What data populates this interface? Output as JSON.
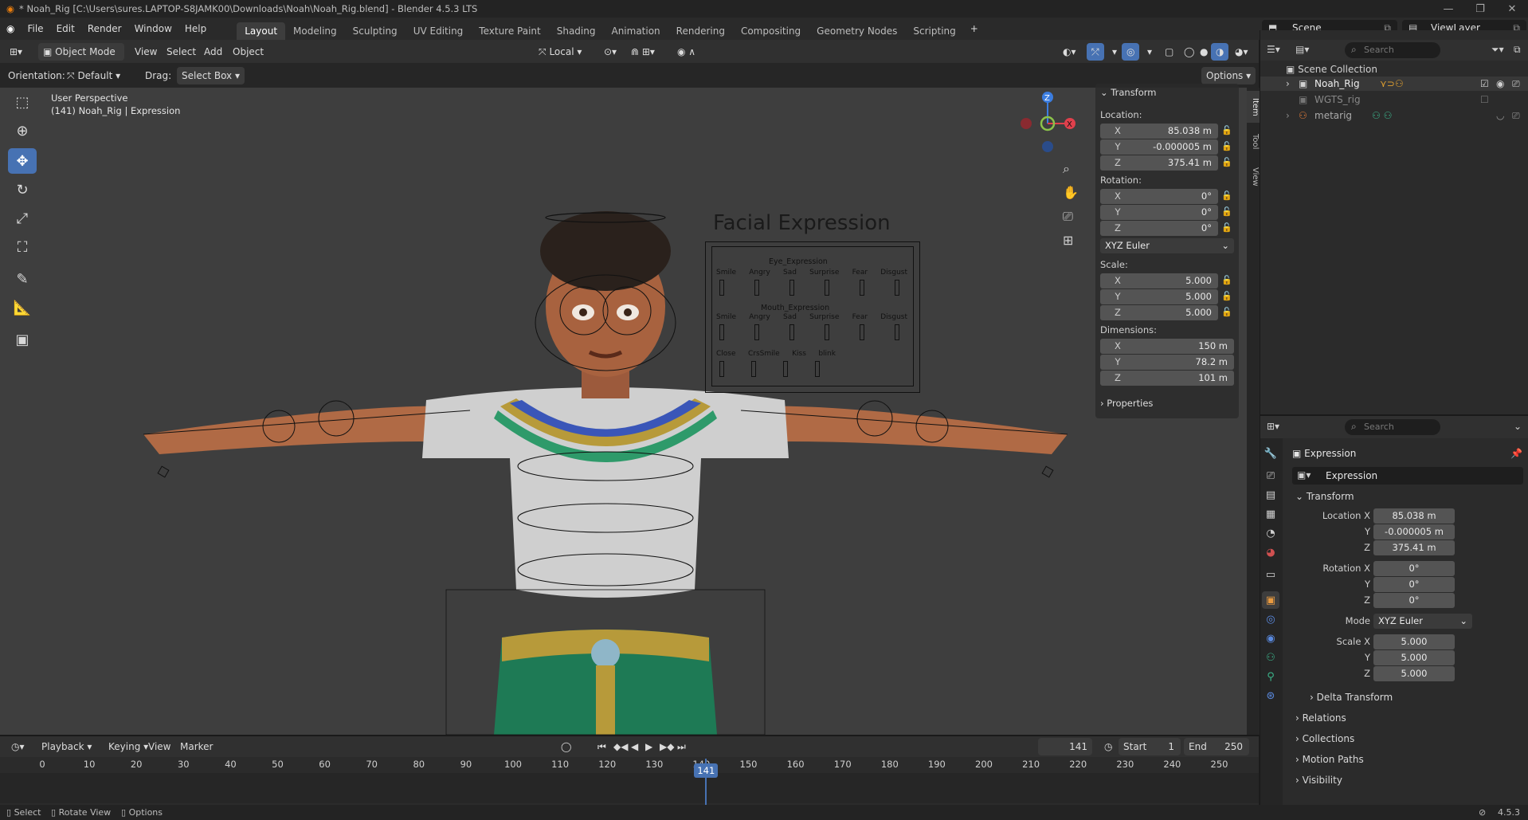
{
  "window": {
    "title": "* Noah_Rig [C:\\Users\\sures.LAPTOP-S8JAMK00\\Downloads\\Noah\\Noah_Rig.blend] - Blender 4.5.3 LTS"
  },
  "menubar": {
    "menus": [
      "File",
      "Edit",
      "Render",
      "Window",
      "Help"
    ],
    "workspaces": [
      "Layout",
      "Modeling",
      "Sculpting",
      "UV Editing",
      "Texture Paint",
      "Shading",
      "Animation",
      "Rendering",
      "Compositing",
      "Geometry Nodes",
      "Scripting"
    ],
    "active_workspace": "Layout",
    "scene": "Scene",
    "view_layer": "ViewLayer"
  },
  "viewport_header": {
    "mode": "Object Mode",
    "menus": [
      "View",
      "Select",
      "Add",
      "Object"
    ],
    "transform_orientation": "Local",
    "orientation_label": "Orientation:",
    "orientation_value": "Default",
    "drag_label": "Drag:",
    "drag_value": "Select Box",
    "options_label": "Options"
  },
  "viewport": {
    "perspective": "User Perspective",
    "object_info": "(141) Noah_Rig | Expression",
    "board": {
      "title": "Facial Expression",
      "eye_section": "Eye_Expression",
      "mouth_section": "Mouth_Expression",
      "eye_labels": [
        "Smile",
        "Angry",
        "Sad",
        "Surprise",
        "Fear",
        "Disgust"
      ],
      "mouth_labels": [
        "Smile",
        "Angry",
        "Sad",
        "Surprise",
        "Fear",
        "Disgust"
      ],
      "extra_labels": [
        "Close",
        "CrsSmile",
        "Kiss",
        "blink"
      ]
    }
  },
  "npanel": {
    "transform_header": "Transform",
    "location_label": "Location:",
    "location": {
      "x": "85.038 m",
      "y": "-0.000005 m",
      "z": "375.41 m"
    },
    "rotation_label": "Rotation:",
    "rotation": {
      "x": "0°",
      "y": "0°",
      "z": "0°"
    },
    "rotation_mode": "XYZ Euler",
    "scale_label": "Scale:",
    "scale": {
      "x": "5.000",
      "y": "5.000",
      "z": "5.000"
    },
    "dimensions_label": "Dimensions:",
    "dimensions": {
      "x": "150 m",
      "y": "78.2 m",
      "z": "101 m"
    },
    "properties_header": "Properties",
    "tabs": [
      "Item",
      "Tool",
      "View"
    ]
  },
  "outliner": {
    "search_placeholder": "Search",
    "root": "Scene Collection",
    "items": [
      {
        "name": "Noah_Rig"
      },
      {
        "name": "WGTS_rig"
      },
      {
        "name": "metarig"
      }
    ]
  },
  "properties": {
    "search_placeholder": "Search",
    "object_name": "Expression",
    "object_field": "Expression",
    "transform_header": "Transform",
    "location_x_label": "Location X",
    "location": {
      "x": "85.038 m",
      "y": "-0.000005 m",
      "z": "375.41 m"
    },
    "rotation_x_label": "Rotation X",
    "rotation": {
      "x": "0°",
      "y": "0°",
      "z": "0°"
    },
    "mode_label": "Mode",
    "mode_value": "XYZ Euler",
    "scale_x_label": "Scale X",
    "scale": {
      "x": "5.000",
      "y": "5.000",
      "z": "5.000"
    },
    "axis_y": "Y",
    "axis_z": "Z",
    "subsections": [
      "Delta Transform",
      "Relations",
      "Collections",
      "Motion Paths",
      "Visibility"
    ]
  },
  "timeline": {
    "menus": [
      "Playback",
      "Keying",
      "View",
      "Marker"
    ],
    "current_frame": "141",
    "start_label": "Start",
    "start": "1",
    "end_label": "End",
    "end": "250",
    "ticks": [
      "0",
      "10",
      "20",
      "30",
      "40",
      "50",
      "60",
      "70",
      "80",
      "90",
      "100",
      "110",
      "120",
      "130",
      "140",
      "150",
      "160",
      "170",
      "180",
      "190",
      "200",
      "210",
      "220",
      "230",
      "240",
      "250"
    ]
  },
  "statusbar": {
    "items": [
      "Select",
      "Rotate View",
      "Options"
    ],
    "version": "4.5.3"
  },
  "colors": {
    "accent": "#4772b3",
    "axis_x": "#e0404c",
    "axis_y": "#8bc34a",
    "axis_z": "#3b7de0",
    "viewport_bg": "#3e3e3e"
  }
}
